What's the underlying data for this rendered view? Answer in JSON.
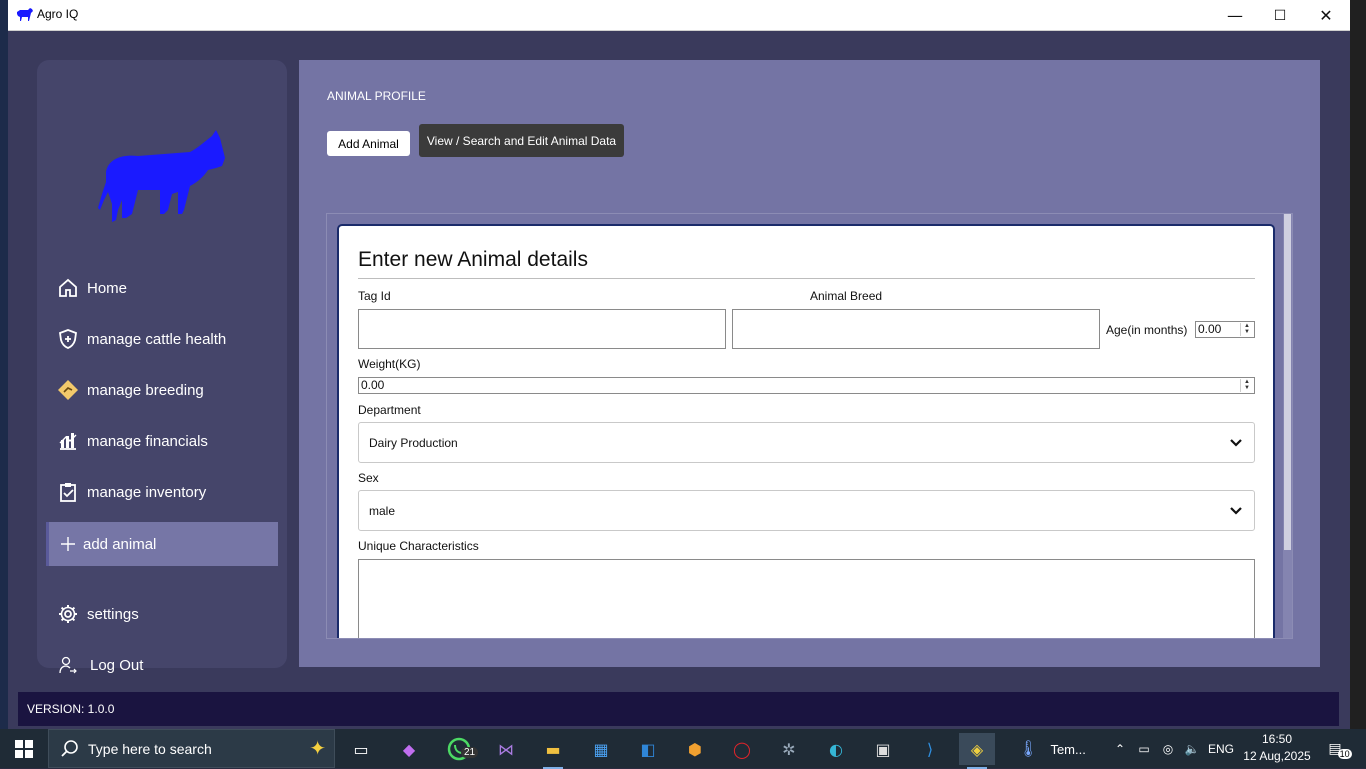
{
  "window": {
    "title": "Agro IQ",
    "controls": {
      "minimize": "—",
      "maximize": "☐",
      "close": "✕"
    }
  },
  "sidebar": {
    "items": [
      {
        "label": "Home",
        "icon": "home-icon"
      },
      {
        "label": "manage cattle health",
        "icon": "shield-plus-icon"
      },
      {
        "label": "manage breeding",
        "icon": "diamond-icon"
      },
      {
        "label": "manage financials",
        "icon": "chart-icon"
      },
      {
        "label": "manage inventory",
        "icon": "clipboard-check-icon"
      },
      {
        "label": "add animal",
        "icon": "plus-icon",
        "active": true
      },
      {
        "label": "settings",
        "icon": "gear-icon"
      },
      {
        "label": "Log Out",
        "icon": "user-logout-icon"
      }
    ]
  },
  "main": {
    "page_title": "ANIMAL PROFILE",
    "tabs": [
      {
        "label": "Add Animal"
      },
      {
        "label": "View / Search and Edit Animal Data"
      }
    ]
  },
  "form": {
    "title": "Enter new Animal details",
    "tag_id_label": "Tag Id",
    "tag_id_value": "",
    "breed_label": "Animal Breed",
    "breed_value": "",
    "age_label": "Age(in months)",
    "age_value": "0.00",
    "weight_label": "Weight(KG)",
    "weight_value": "0.00",
    "department_label": "Department",
    "department_value": "Dairy Production",
    "sex_label": "Sex",
    "sex_value": "male",
    "unique_label": "Unique Characteristics",
    "unique_value": ""
  },
  "footer": {
    "version": "VERSION: 1.0.0"
  },
  "taskbar": {
    "search_placeholder": "Type here to search",
    "whatsapp_badge": "21",
    "temp_label": "Tem...",
    "language": "ENG",
    "time": "16:50",
    "date": "12 Aug,2025",
    "notifications": "10"
  },
  "colors": {
    "sidebar_bg": "#45456a",
    "main_bg": "#7474a4",
    "active_item": "#7676a6",
    "logo": "#1a1aff",
    "version_bar": "#1a1440"
  }
}
